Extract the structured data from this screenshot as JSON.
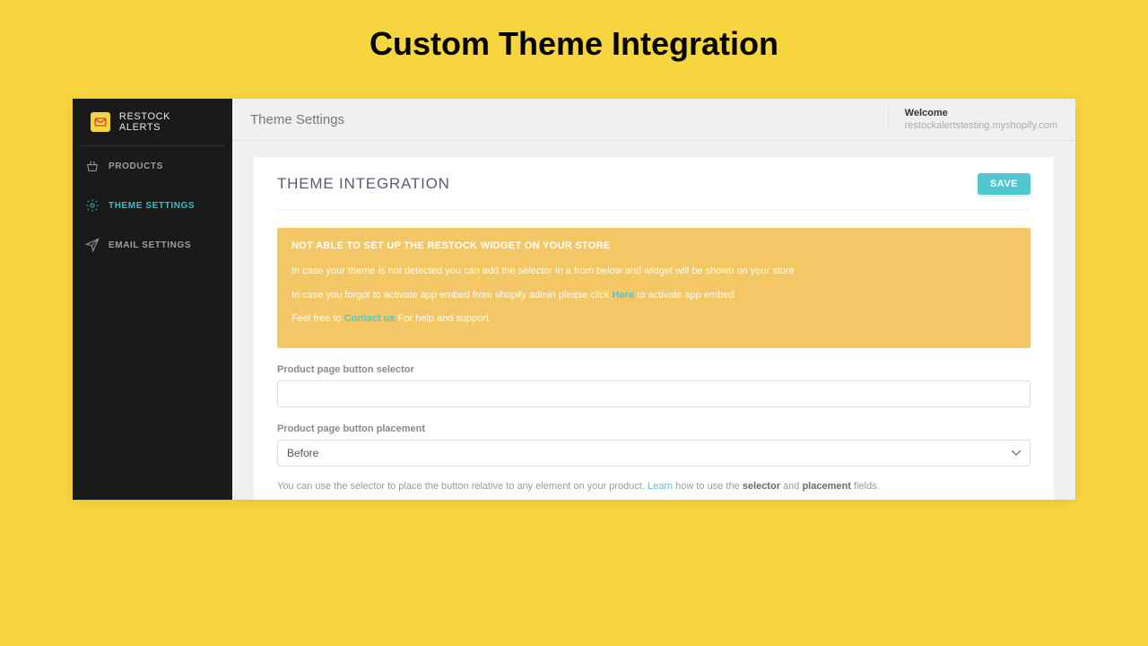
{
  "page_heading": "Custom Theme Integration",
  "sidebar": {
    "brand": "RESTOCK ALERTS",
    "items": [
      {
        "label": "PRODUCTS"
      },
      {
        "label": "THEME SETTINGS"
      },
      {
        "label": "EMAIL SETTINGS"
      }
    ]
  },
  "topbar": {
    "title": "Theme Settings",
    "welcome_label": "Welcome",
    "welcome_domain": "restockalertstesting.myshopify.com"
  },
  "card": {
    "title": "THEME INTEGRATION",
    "save_label": "SAVE"
  },
  "alert": {
    "title": "NOT ABLE TO SET UP THE RESTOCK WIDGET ON YOUR STORE",
    "line1": "In case your theme is not detected you can add the selector in a from below and widget will be shown on your store",
    "line2_pre": "In case you forgot to activate app embed from shopify admin please click ",
    "line2_link": "Here",
    "line2_post": " to activate app embed",
    "line3_pre": "Feel free to ",
    "line3_link": "Contact us",
    "line3_post": " For help and support"
  },
  "form": {
    "selector_label": "Product page button selector",
    "selector_value": "",
    "placement_label": "Product page button placement",
    "placement_value": "Before",
    "hint_pre": "You can use the selector to place the button relative to any element on your product. ",
    "hint_link": "Learn",
    "hint_mid": " how to use the ",
    "hint_b1": "selector",
    "hint_and": " and ",
    "hint_b2": "placement",
    "hint_post": " fields."
  }
}
